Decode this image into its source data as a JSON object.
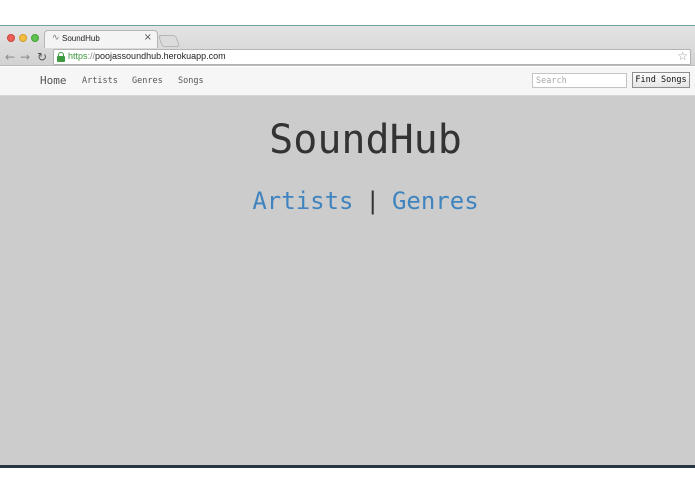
{
  "browser": {
    "tab_title": "SoundHub",
    "tab_close": "×",
    "url_scheme": "https",
    "url_separator": "://",
    "url_host": "poojassoundhub.herokuapp.com"
  },
  "navbar": {
    "brand": "Home",
    "links": [
      "Artists",
      "Genres",
      "Songs"
    ],
    "search_placeholder": "Search",
    "find_button": "Find Songs"
  },
  "hero": {
    "title": "SoundHub",
    "link_artists": "Artists",
    "separator": "|",
    "link_genres": "Genres"
  },
  "colors": {
    "page_background": "#cccccc",
    "link": "#3f84bf",
    "title": "#333333"
  }
}
